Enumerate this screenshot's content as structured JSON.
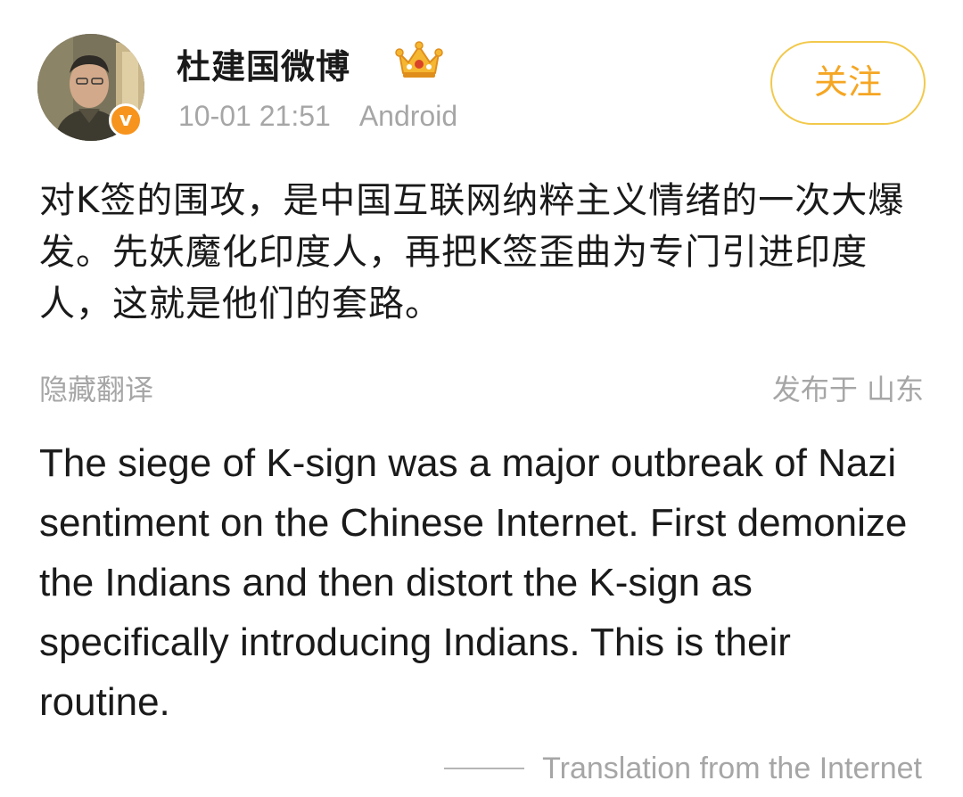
{
  "header": {
    "user_name": "杜建国微博",
    "timestamp": "10-01 21:51",
    "source": "Android",
    "follow_label": "关注",
    "verified_badge": "v",
    "avatar_icon": "user-avatar-photo",
    "rank_icon": "crown-icon"
  },
  "post": {
    "content_zh": "对K签的围攻，是中国互联网纳粹主义情绪的一次大爆发。先妖魔化印度人，再把K签歪曲为专门引进印度人，这就是他们的套路。",
    "hide_translation_label": "隐藏翻译",
    "location": "发布于 山东",
    "content_en": "The siege of K-sign was a major outbreak of Nazi sentiment on the Chinese Internet. First demonize the Indians and then distort the K-sign as specifically introducing Indians. This is their routine.",
    "translation_credit": "Translation from the Internet"
  },
  "colors": {
    "accent": "#f5a623",
    "follow_border": "#f2c94c",
    "muted_text": "#a6a6a6",
    "verified_badge": "#f7941d"
  }
}
